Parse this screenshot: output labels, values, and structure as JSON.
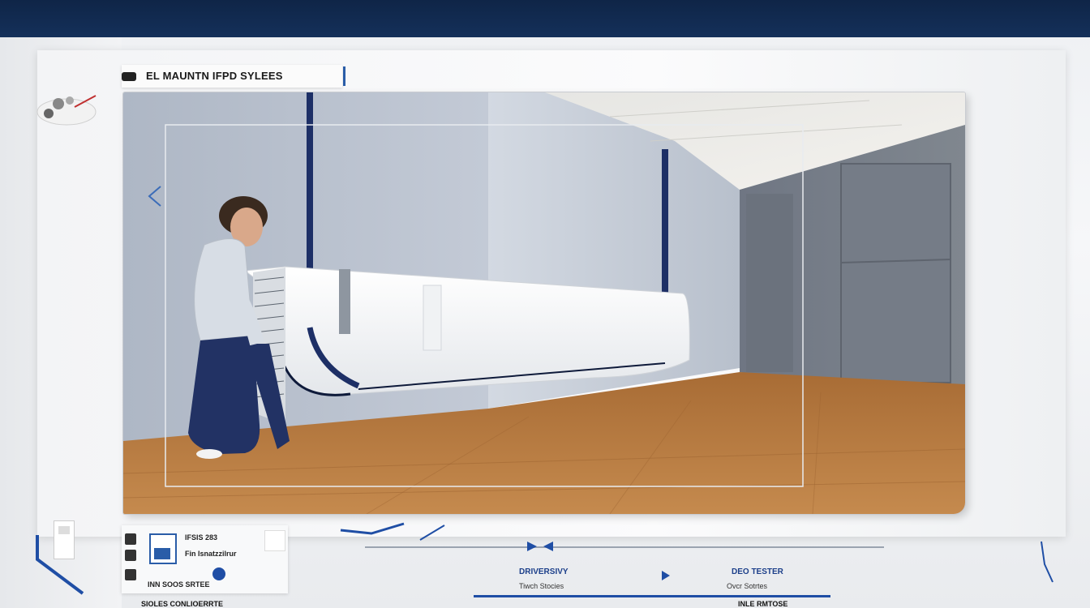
{
  "window": {
    "title": "EL MAUNTN IFPD SYLEES"
  },
  "bottom_panel": {
    "info_line_1": "IFSIS 283",
    "info_line_2": "Fin Isnatzzilrur",
    "info_line_3": "INN SOOS SRTEE",
    "center_title": "DRIVERSIVY",
    "center_sub": "Tiwch Stocies",
    "right_title": "DEO TESTER",
    "right_sub": "Ovcr Sotrtes"
  },
  "footer": {
    "text_left": "SIOLES CONLIOERRTE",
    "text_right": "INLE RMTOSE"
  },
  "colors": {
    "accent": "#1f4ea5",
    "topbar": "#0f2547",
    "floor": "#b87a3f"
  },
  "icons": [
    "camera-icon",
    "logo-icon",
    "prev-icon",
    "tool-icon",
    "document-icon",
    "remote-icon",
    "dot-icon"
  ]
}
